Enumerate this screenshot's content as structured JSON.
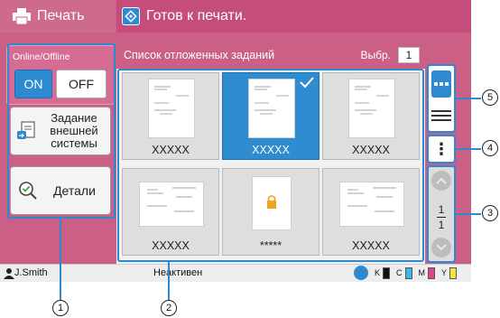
{
  "header": {
    "app_title": "Печать",
    "status_title": "Готов к печати."
  },
  "left_panel": {
    "online_label": "Online/Offline",
    "on_label": "ON",
    "off_label": "OFF",
    "external_label": "Задание внешней системы",
    "details_label": "Детали"
  },
  "list": {
    "title": "Список отложенных заданий",
    "select_label": "Выбр.",
    "select_count": "1",
    "jobs": [
      {
        "name": "XXXXX",
        "selected": false,
        "icon": "document-thumbnail"
      },
      {
        "name": "XXXXX",
        "selected": true,
        "icon": "document-thumbnail"
      },
      {
        "name": "XXXXX",
        "selected": false,
        "icon": "document-thumbnail"
      },
      {
        "name": "XXXXX",
        "selected": false,
        "icon": "document-thumbnail"
      },
      {
        "name": "*****",
        "selected": false,
        "icon": "lock-icon"
      },
      {
        "name": "XXXXX",
        "selected": false,
        "icon": "document-thumbnail"
      }
    ]
  },
  "pager": {
    "current": "1",
    "total": "1"
  },
  "more_label": "⋮",
  "footer": {
    "user": "J.Smith",
    "state": "Неактивен",
    "inks": [
      {
        "label": "K",
        "color": "#111111"
      },
      {
        "label": "C",
        "color": "#39b7e8"
      },
      {
        "label": "M",
        "color": "#e0428f"
      },
      {
        "label": "Y",
        "color": "#f5e23a"
      }
    ]
  },
  "callouts": [
    "1",
    "2",
    "3",
    "4",
    "5"
  ],
  "colors": {
    "accent": "#cc5f86",
    "header_right": "#c54d7b",
    "blue": "#2e8ad0"
  }
}
